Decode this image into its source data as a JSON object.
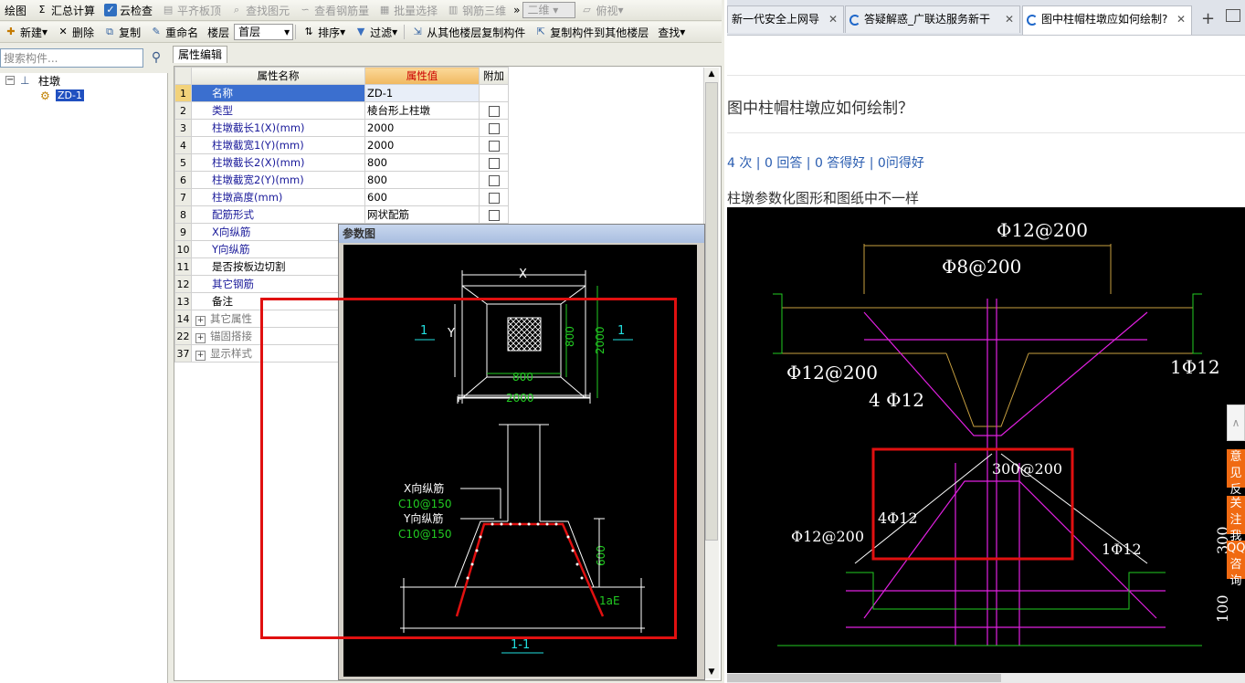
{
  "toolbar1": [
    {
      "label": "绘图",
      "icon": "draw-icon",
      "disabled": false
    },
    {
      "label": "汇总计算",
      "icon": "sigma-icon",
      "disabled": false
    },
    {
      "label": "云检查",
      "icon": "cloud-check-icon",
      "disabled": false
    },
    {
      "label": "平齐板顶",
      "icon": "flush-slab-icon",
      "disabled": true
    },
    {
      "label": "查找图元",
      "icon": "find-element-icon",
      "disabled": true
    },
    {
      "label": "查看钢筋量",
      "icon": "view-rebar-icon",
      "disabled": true
    },
    {
      "label": "批量选择",
      "icon": "batch-select-icon",
      "disabled": true
    },
    {
      "label": "钢筋三维",
      "icon": "rebar-3d-icon",
      "disabled": true
    }
  ],
  "view_2d": "二维",
  "view_top": "俯视",
  "toolbar2": [
    {
      "label": "新建",
      "icon": "new-icon"
    },
    {
      "label": "删除",
      "icon": "delete-icon"
    },
    {
      "label": "复制",
      "icon": "copy-icon"
    },
    {
      "label": "重命名",
      "icon": "rename-icon"
    },
    {
      "label": "楼层",
      "icon": ""
    }
  ],
  "floor_value": "首层",
  "toolbar2b": [
    {
      "label": "排序",
      "icon": "sort-icon"
    },
    {
      "label": "过滤",
      "icon": "filter-icon"
    },
    {
      "label": "从其他楼层复制构件",
      "icon": "copy-from-floor-icon"
    },
    {
      "label": "复制构件到其他楼层",
      "icon": "copy-to-floor-icon"
    },
    {
      "label": "查找",
      "icon": ""
    }
  ],
  "search_placeholder": "搜索构件...",
  "tree": {
    "root": "柱墩",
    "child": "ZD-1"
  },
  "panel_tab": "属性编辑",
  "grid_headers": {
    "name": "属性名称",
    "value": "属性值",
    "extra": "附加"
  },
  "rows": [
    {
      "no": "1",
      "name": "名称",
      "value": "ZD-1",
      "check": false,
      "style": "blue"
    },
    {
      "no": "2",
      "name": "类型",
      "value": "棱台形上柱墩",
      "check": true,
      "style": "blue"
    },
    {
      "no": "3",
      "name": "柱墩截长1(X)(mm)",
      "value": "2000",
      "check": true,
      "style": "blue"
    },
    {
      "no": "4",
      "name": "柱墩截宽1(Y)(mm)",
      "value": "2000",
      "check": true,
      "style": "blue"
    },
    {
      "no": "5",
      "name": "柱墩截长2(X)(mm)",
      "value": "800",
      "check": true,
      "style": "blue"
    },
    {
      "no": "6",
      "name": "柱墩截宽2(Y)(mm)",
      "value": "800",
      "check": true,
      "style": "blue"
    },
    {
      "no": "7",
      "name": "柱墩高度(mm)",
      "value": "600",
      "check": true,
      "style": "blue"
    },
    {
      "no": "8",
      "name": "配筋形式",
      "value": "网状配筋",
      "check": true,
      "style": "blue"
    },
    {
      "no": "9",
      "name": "X向纵筋",
      "value": "",
      "check": false,
      "style": "blue"
    },
    {
      "no": "10",
      "name": "Y向纵筋",
      "value": "",
      "check": false,
      "style": "blue"
    },
    {
      "no": "11",
      "name": "是否按板边切割",
      "value": "",
      "check": false,
      "style": "plain"
    },
    {
      "no": "12",
      "name": "其它钢筋",
      "value": "",
      "check": false,
      "style": "blue"
    },
    {
      "no": "13",
      "name": "备注",
      "value": "",
      "check": false,
      "style": "plain"
    },
    {
      "no": "14",
      "name": "其它属性",
      "value": "",
      "check": false,
      "style": "grey"
    },
    {
      "no": "22",
      "name": "锚固搭接",
      "value": "",
      "check": false,
      "style": "grey"
    },
    {
      "no": "37",
      "name": "显示样式",
      "value": "",
      "check": false,
      "style": "grey"
    }
  ],
  "dialog": {
    "title": "参数图",
    "labels": {
      "x": "X",
      "y": "Y",
      "sec_left": "1",
      "sec_right": "1",
      "d800a": "800",
      "d800b": "800",
      "d2000a": "2000",
      "d2000b": "2000",
      "xbar": "X向纵筋",
      "xbar_val": "C10@150",
      "ybar": "Y向纵筋",
      "ybar_val": "C10@150",
      "h600": "600",
      "lae": "1aE",
      "section": "1-1"
    }
  },
  "browser": {
    "tabs": [
      {
        "title": "新一代安全上网导"
      },
      {
        "title": "答疑解惑_广联达服务新干"
      },
      {
        "title": "图中柱帽柱墩应如何绘制?"
      }
    ],
    "new_tab": "+",
    "question_title": "图中柱帽柱墩应如何绘制？",
    "stats": "4 次 | 0 回答 | 0 答得好 | 0问得好",
    "desc": "柱墩参数化图形和图纸中不一样",
    "cad_labels": {
      "a": "Φ12@200",
      "b": "Φ8@200",
      "c": "Φ12@200",
      "d": "1Φ12",
      "e": "4 Φ12",
      "f": "300@200",
      "g": "4Φ12",
      "h": "Φ12@200",
      "i": "1Φ12",
      "j": "300",
      "k": "100"
    },
    "side_buttons": [
      "意见反馈",
      "关注我们",
      "QQ咨询"
    ]
  },
  "colors": {
    "accent_red": "#e01010",
    "cad_green": "#22cc22",
    "cad_cyan": "#22e0e0",
    "cad_magenta": "#e020e0",
    "value_header": "#f5c070"
  }
}
